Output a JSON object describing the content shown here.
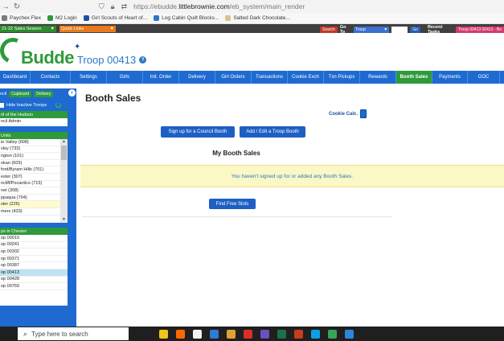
{
  "browser": {
    "url_prefix": "https://ebudde.",
    "url_domain": "littlebrownie.com",
    "url_path": "/eb_system/main_render"
  },
  "bookmarks": [
    {
      "label": "Paychex Flex",
      "color": "#7a7a7a"
    },
    {
      "label": "M2 Login",
      "color": "#2e9a3a"
    },
    {
      "label": "Girl Scouts of Heart of...",
      "color": "#1e4ea1"
    },
    {
      "label": "Log Cabin Quilt Blocks...",
      "color": "#2a78c4"
    },
    {
      "label": "Salted Dark Chocolate...",
      "color": "#d9c28a"
    }
  ],
  "toolbar": {
    "season": "21-22 Sales Season",
    "quick_links": "Quick Links",
    "search_btn": "Search",
    "goto_label": "Go To",
    "goto_select": "Troop",
    "go_btn": "Go",
    "recent_label": "Recent Tasks",
    "recent_item": "Troop 00413 00413 - Bo"
  },
  "header": {
    "logo": "Budde",
    "troop": "Troop 00413"
  },
  "nav": [
    {
      "label": "Dashboard",
      "w": 38
    },
    {
      "label": "Contacts",
      "w": 50
    },
    {
      "label": "Settings",
      "w": 45
    },
    {
      "label": "Girls",
      "w": 45
    },
    {
      "label": "Init. Order",
      "w": 45
    },
    {
      "label": "Delivery",
      "w": 45
    },
    {
      "label": "Girl Orders",
      "w": 45
    },
    {
      "label": "Transactions",
      "w": 45
    },
    {
      "label": "Cookie Exch",
      "w": 45
    },
    {
      "label": "Txn Pickups",
      "w": 45
    },
    {
      "label": "Rewards",
      "w": 45
    },
    {
      "label": "Booth Sales",
      "w": 45,
      "active": true
    },
    {
      "label": "Payments",
      "w": 44
    },
    {
      "label": "GOC",
      "w": 40
    }
  ],
  "sidebar": {
    "top_label": "ncil",
    "cupboard": "Cupboard",
    "delivery": "Delivery",
    "hide_inactive": "Hide Inactive Troops",
    "council_head": "ril of the Hudson",
    "council_row": "ncil Admin",
    "units_head": "Units",
    "units": [
      "ie Valley (608)",
      "sley (733)",
      "ngton (101)",
      "okan (603)",
      "ford/Byram Hills (701)",
      "ester (307)",
      "ncliff/Pocantico (715)",
      "net (308)",
      "ppaqua (704)",
      "ster (226)",
      "mers (433)"
    ],
    "units_selected": 9,
    "troops_head": "ps in Chester",
    "troops": [
      "op 00010",
      "op 00241",
      "op 00302",
      "op 00371",
      "op 00387",
      "op 00413",
      "op 00428",
      "op 00769"
    ],
    "troops_selected": 5
  },
  "content": {
    "title": "Booth Sales",
    "cookie_calc": "Cookie Calc.",
    "signup_btn": "Sign up for a Council Booth",
    "addedit_btn": "Add / Edit a Troop Booth",
    "my_booth": "My Booth Sales",
    "note": "You haven't signed up for or added any Booth Sales.",
    "find_btn": "Find Free Slots"
  },
  "taskbar": {
    "search_placeholder": "Type here to search",
    "icons": [
      "#f0c419",
      "#ff6a00",
      "#f2f2f2",
      "#2b7cd3",
      "#e0a030",
      "#d93025",
      "#6b4fbb",
      "#1d7045",
      "#c43e1c",
      "#0aa0e8",
      "#38a35a",
      "#2a88d8"
    ]
  }
}
